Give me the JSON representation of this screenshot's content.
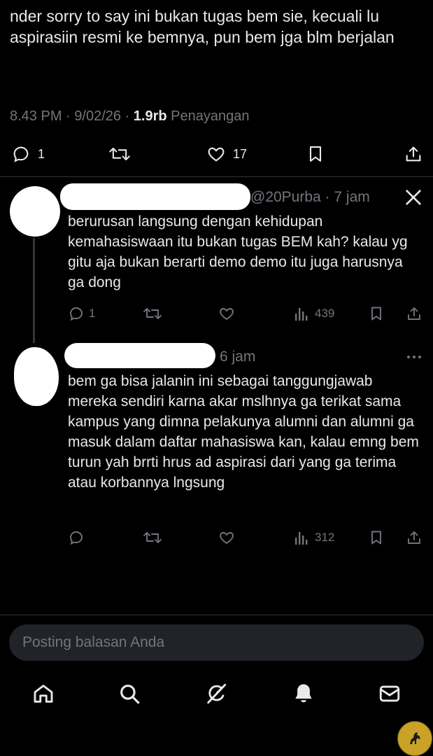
{
  "main_tweet": {
    "text": "nder sorry to say ini bukan tugas bem sie, kecuali lu aspirasiin resmi ke bemnya, pun bem jga blm berjalan",
    "time": "8.43 PM",
    "date": "9/02/26",
    "views_count": "1.9rb",
    "views_label": "Penayangan",
    "reply_count": "1",
    "like_count": "17"
  },
  "reply1": {
    "handle": "@20Purba",
    "time_ago": "7 jam",
    "text": "berurusan langsung dengan kehidupan kemahasiswaan itu bukan tugas BEM kah? kalau yg gitu aja bukan berarti demo demo itu juga harusnya ga dong",
    "reply_count": "1",
    "view_count": "439"
  },
  "reply2": {
    "time_ago": "6 jam",
    "text": "bem ga bisa jalanin ini sebagai tanggungjawab mereka sendiri karna akar mslhnya ga terikat sama kampus yang dimna pelakunya alumni dan alumni ga masuk dalam daftar mahasiswa kan, kalau emng bem turun yah brrti hrus ad aspirasi dari yang ga terima atau korbannya lngsung",
    "view_count": "312"
  },
  "reply_box": {
    "placeholder": "Posting balasan Anda"
  },
  "nav": [
    "home-icon",
    "search-icon",
    "grok-icon",
    "notifications-icon",
    "messages-icon"
  ],
  "colors": {
    "background": "#000000",
    "text": "#e7e9ea",
    "muted": "#71767b",
    "divider": "#2f3336",
    "input": "#202327"
  }
}
